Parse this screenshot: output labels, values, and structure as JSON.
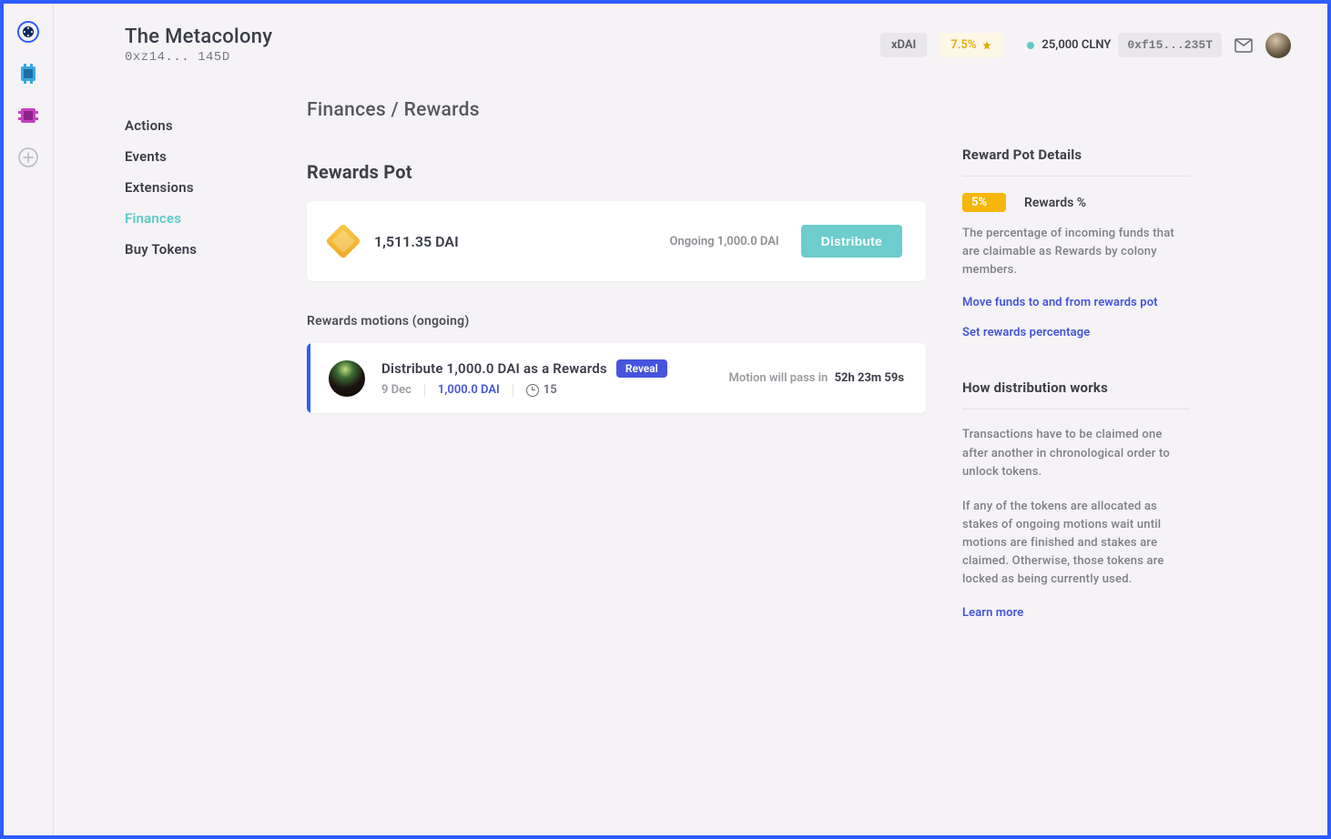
{
  "header": {
    "title": "The Metacolony",
    "address": "0xz14... 145D",
    "network_chip": "xDAI",
    "percent_chip": "7.5%",
    "balance": "25,000 CLNY",
    "wallet_address": "0xf15...235T"
  },
  "nav": {
    "items": [
      "Actions",
      "Events",
      "Extensions",
      "Finances",
      "Buy Tokens"
    ],
    "active_index": 3
  },
  "breadcrumb": "Finances / Rewards",
  "rewards_pot": {
    "title": "Rewards Pot",
    "balance": "1,511.35 DAI",
    "ongoing": "Ongoing 1,000.0 DAI",
    "distribute_label": "Distribute"
  },
  "motions": {
    "title": "Rewards motions (ongoing)",
    "items": [
      {
        "title": "Distribute 1,000.0 DAI as a Rewards",
        "badge": "Reveal",
        "date": "9 Dec",
        "amount": "1,000.0 DAI",
        "count": "15",
        "timer_prefix": "Motion will pass in",
        "timer_value": "52h 23m 59s"
      }
    ]
  },
  "details": {
    "title": "Reward Pot Details",
    "percent": "5%",
    "percent_label": "Rewards %",
    "percent_desc": "The percentage of incoming funds that are claimable as Rewards by colony members.",
    "link_move": "Move funds to and from rewards pot",
    "link_set": "Set rewards percentage",
    "how_title": "How distribution works",
    "how_p1": "Transactions have to be claimed one after another in chronological order to unlock tokens.",
    "how_p2": "If any of the tokens are allocated as stakes of ongoing motions wait until motions are finished and stakes are claimed. Otherwise, those tokens are locked as being currently used.",
    "learn_more": "Learn more"
  }
}
